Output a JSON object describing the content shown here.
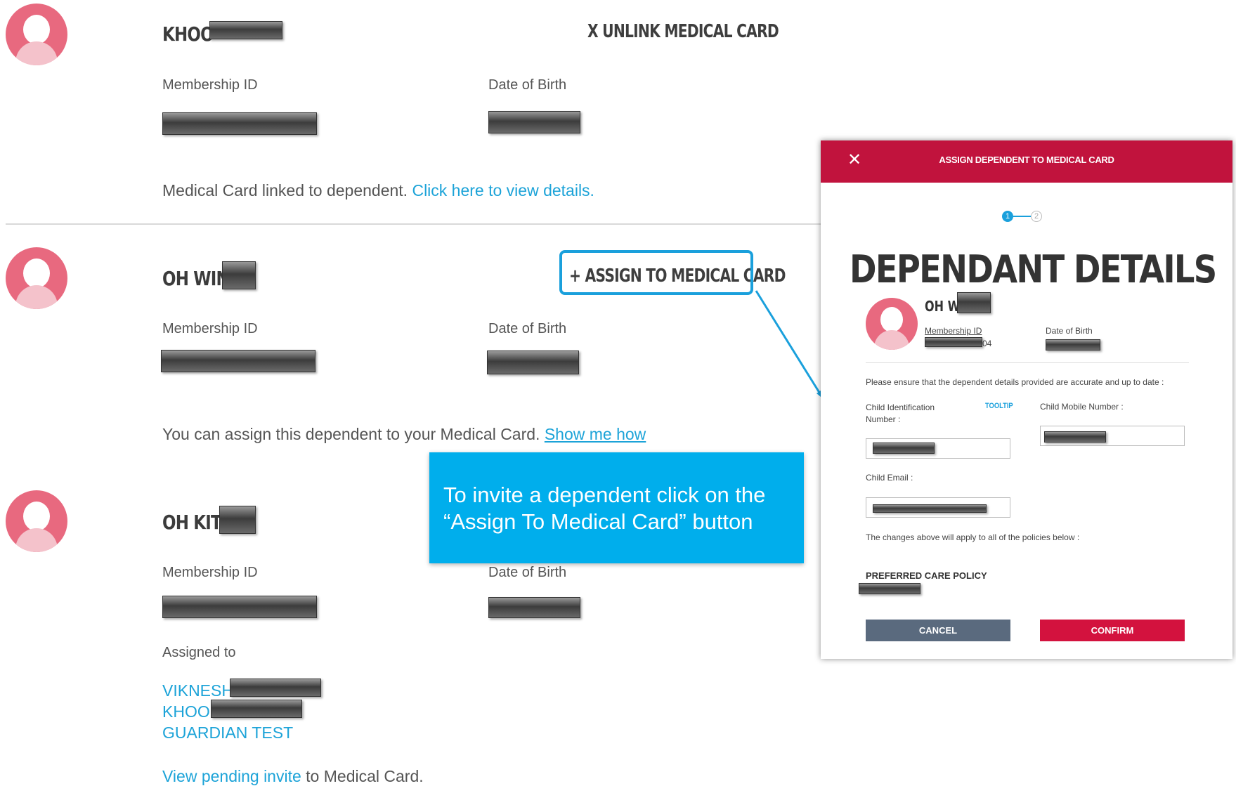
{
  "dependents": [
    {
      "name": "KHOO",
      "action": "X UNLINK MEDICAL CARD",
      "membership_label": "Membership ID",
      "dob_label": "Date of Birth",
      "status_text": "Medical Card linked to dependent.",
      "status_link": "Click here to view details."
    },
    {
      "name": "OH WIN",
      "action": "+ ASSIGN TO MEDICAL CARD",
      "membership_label": "Membership ID",
      "dob_label": "Date of Birth",
      "status_text": "You can assign this dependent to your Medical Card.",
      "status_link": "Show me how"
    },
    {
      "name": "OH KIT",
      "membership_label": "Membership ID",
      "dob_label": "Date of Birth",
      "assigned_label": "Assigned to",
      "assigned": [
        "VIKNESH",
        "KHOO",
        "GUARDIAN TEST"
      ],
      "pending_link": "View pending invite",
      "pending_text": "to Medical Card."
    }
  ],
  "callout": "To invite a dependent click on the “Assign To Medical Card” button",
  "modal": {
    "title": "ASSIGN DEPENDENT TO MEDICAL CARD",
    "close": "✕",
    "steps": [
      "1",
      "2"
    ],
    "heading": "DEPENDANT DETAILS",
    "dependent_name": "OH WI",
    "membership_label": "Membership ID",
    "membership_suffix": "04",
    "dob_label": "Date of Birth",
    "notice": "Please ensure that the dependent details provided are accurate and up to date :",
    "child_id_label": "Child Identification Number :",
    "tooltip": "TOOLTIP",
    "child_mobile_label": "Child Mobile Number :",
    "child_email_label": "Child Email :",
    "apply_note": "The changes above will apply to all of the policies below :",
    "policy_name": "PREFERRED CARE POLICY",
    "cancel": "CANCEL",
    "confirm": "CONFIRM"
  },
  "colors": {
    "accent": "#1aa0dc",
    "brand": "#c1133d",
    "callout": "#00aeec"
  }
}
